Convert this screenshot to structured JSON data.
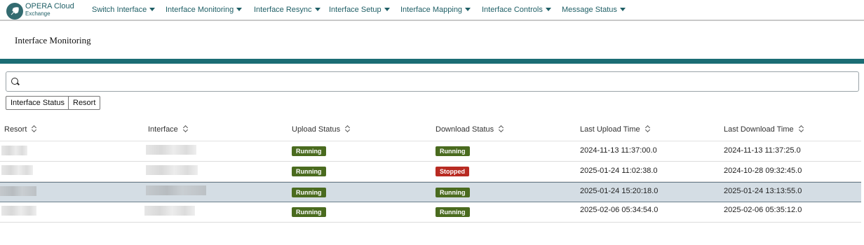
{
  "app": {
    "brand_line1": "OPERA Cloud",
    "brand_line2": "Exchange"
  },
  "nav": [
    {
      "label": "Switch Interface"
    },
    {
      "label": "Interface Monitoring"
    },
    {
      "label": "Interface Resync"
    },
    {
      "label": "Interface Setup"
    },
    {
      "label": "Interface Mapping"
    },
    {
      "label": "Interface Controls"
    },
    {
      "label": "Message Status"
    }
  ],
  "page": {
    "title": "Interface Monitoring"
  },
  "search": {
    "value": "",
    "placeholder": ""
  },
  "filters": [
    {
      "label": "Interface Status"
    },
    {
      "label": "Resort"
    }
  ],
  "table": {
    "columns": [
      "Resort",
      "Interface",
      "Upload Status",
      "Download Status",
      "Last Upload Time",
      "Last Download Time"
    ],
    "rows": [
      {
        "upload_status": "Running",
        "download_status": "Running",
        "last_upload": "2024-11-13 11:37:00.0",
        "last_download": "2024-11-13 11:37:25.0"
      },
      {
        "upload_status": "Running",
        "download_status": "Stopped",
        "last_upload": "2025-01-24 11:02:38.0",
        "last_download": "2024-10-28 09:32:45.0"
      },
      {
        "upload_status": "Running",
        "download_status": "Running",
        "last_upload": "2025-01-24 15:20:18.0",
        "last_download": "2025-01-24 13:13:55.0"
      },
      {
        "upload_status": "Running",
        "download_status": "Running",
        "last_upload": "2025-02-06 05:34:54.0",
        "last_download": "2025-02-06 05:35:12.0"
      }
    ]
  },
  "colors": {
    "accent": "#1b6d74",
    "running": "#4a6b1f",
    "stopped": "#b82b22",
    "selected_row": "#d4dde4"
  }
}
